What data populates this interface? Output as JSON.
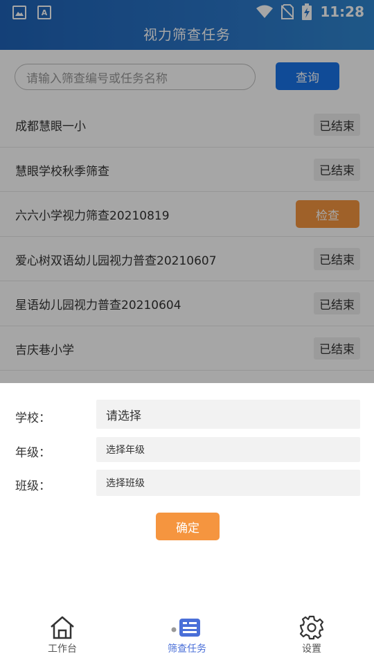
{
  "status_bar": {
    "time": "11:28",
    "icons": [
      "image-icon",
      "a-icon",
      "wifi-icon",
      "no-sim-icon",
      "battery-icon"
    ]
  },
  "header": {
    "title": "视力筛查任务"
  },
  "search": {
    "placeholder": "请输入筛查编号或任务名称",
    "button_label": "查询"
  },
  "tasks": [
    {
      "name": "成都慧眼一小",
      "status": "已结束"
    },
    {
      "name": "慧眼学校秋季筛查",
      "status": "已结束"
    },
    {
      "name": "六六小学视力筛查20210819",
      "action": "检查"
    },
    {
      "name": "爱心树双语幼儿园视力普查20210607",
      "status": "已结束"
    },
    {
      "name": "星语幼儿园视力普查20210604",
      "status": "已结束"
    },
    {
      "name": "吉庆巷小学",
      "status": "已结束"
    }
  ],
  "dialog": {
    "school_label": "学校：",
    "school_value": "请选择",
    "grade_label": "年级：",
    "grade_placeholder": "选择年级",
    "class_label": "班级：",
    "class_placeholder": "选择班级",
    "confirm_label": "确定"
  },
  "tabbar": {
    "items": [
      {
        "label": "工作台",
        "icon": "home-icon"
      },
      {
        "label": "筛查任务",
        "icon": "task-card-icon",
        "active": true
      },
      {
        "label": "设置",
        "icon": "gear-icon"
      }
    ]
  },
  "colors": {
    "primary": "#1a73e8",
    "accent": "#f5953f",
    "header": "#2a76c8",
    "tab_active": "#4a6fd8"
  }
}
